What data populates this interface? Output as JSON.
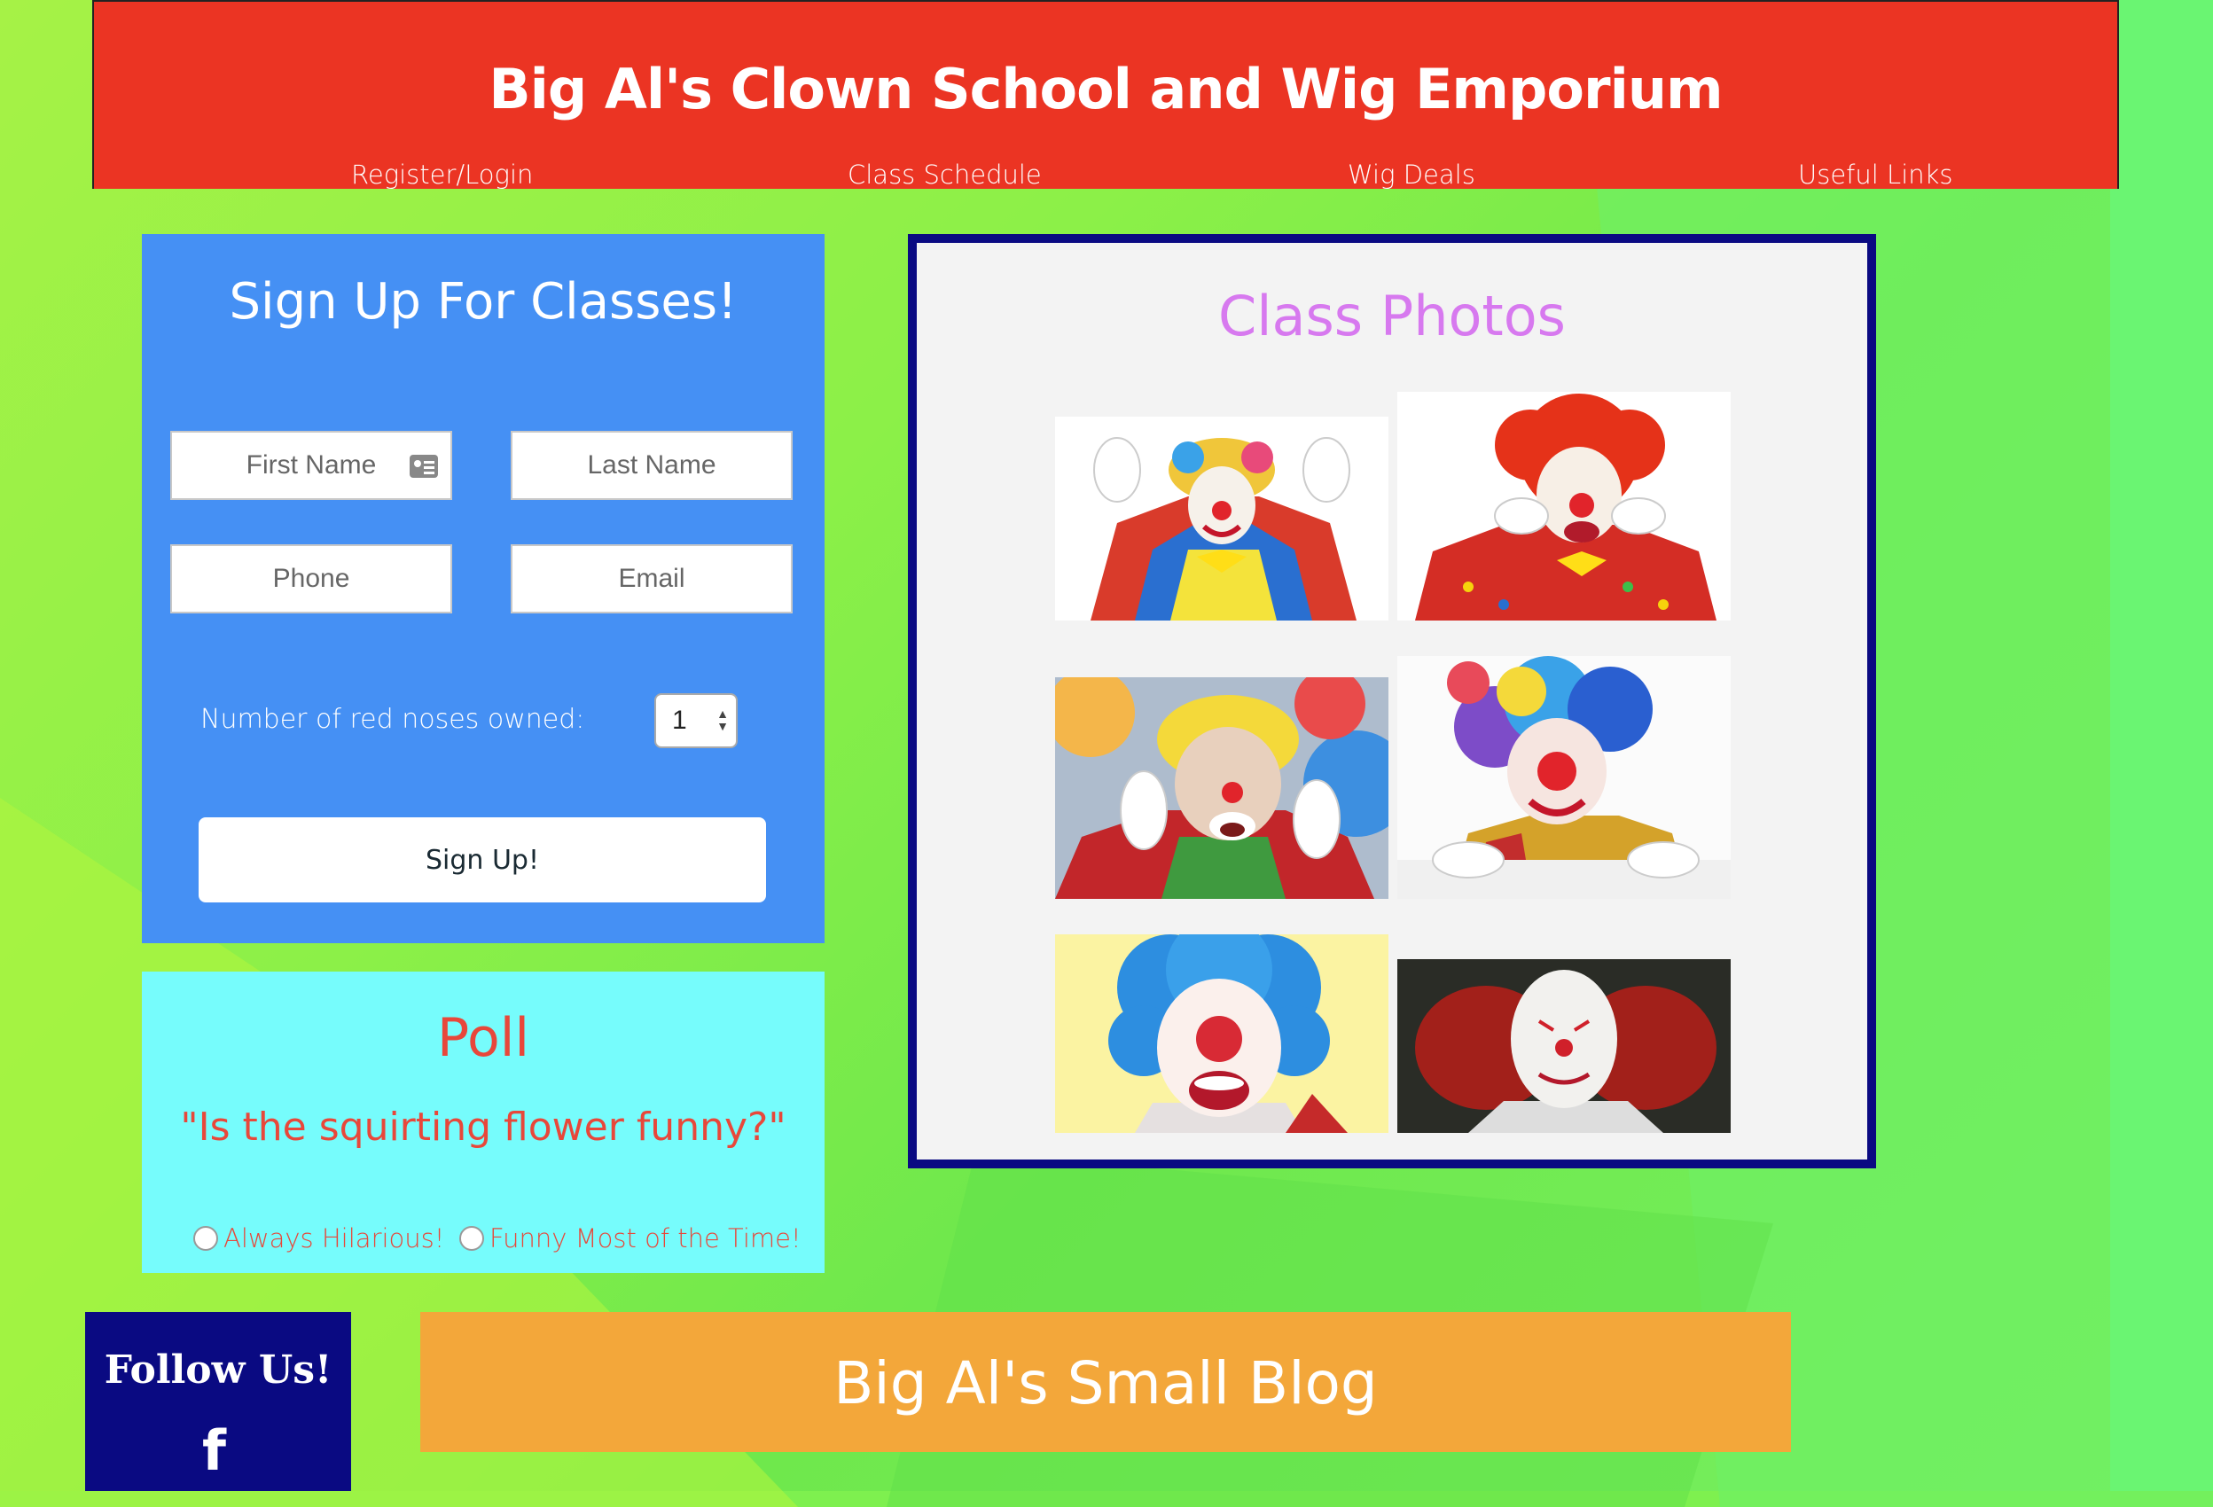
{
  "header": {
    "title": "Big Al's Clown School and Wig Emporium",
    "nav": [
      "Register/Login",
      "Class Schedule",
      "Wig Deals",
      "Useful Links"
    ]
  },
  "signup": {
    "heading": "Sign Up For Classes!",
    "first_name_placeholder": "First Name",
    "last_name_placeholder": "Last Name",
    "phone_placeholder": "Phone",
    "email_placeholder": "Email",
    "noses_label": "Number of red noses owned:",
    "noses_value": "1",
    "submit_label": "Sign Up!"
  },
  "poll": {
    "heading": "Poll",
    "question": "\"Is the squirting flower funny?\"",
    "options": [
      "Always Hilarious!",
      "Funny Most of the Time!"
    ]
  },
  "photos": {
    "heading": "Class Photos",
    "items": [
      "clown-photo",
      "clown-photo",
      "clown-photo",
      "clown-photo",
      "clown-photo",
      "clown-photo"
    ]
  },
  "follow": {
    "title": "Follow Us!",
    "icon": "facebook-icon",
    "glyph": "f"
  },
  "blog": {
    "heading": "Big Al's Small Blog"
  },
  "colors": {
    "header": "#eb3423",
    "signup_panel": "#4590f4",
    "poll_panel": "#76fcfc",
    "photos_border": "#0a0a82",
    "photos_title": "#d779ef",
    "blog_bar": "#f3a73a",
    "follow_panel": "#0a0a82",
    "background": "#7ef04f"
  }
}
